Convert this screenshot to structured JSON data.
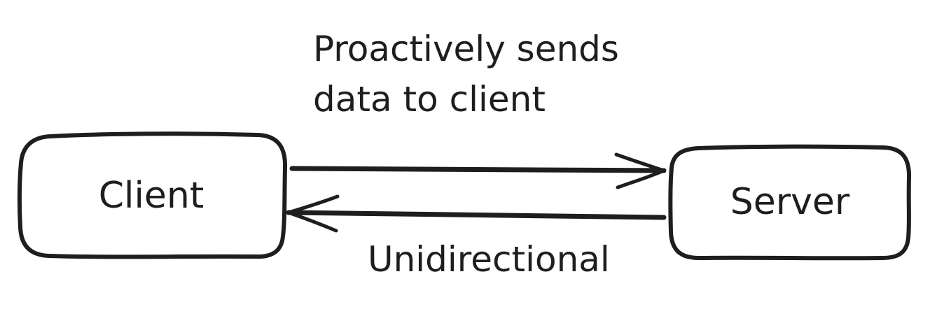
{
  "nodes": {
    "client": {
      "label": "Client"
    },
    "server": {
      "label": "Server"
    }
  },
  "annotations": {
    "top_line_1": "Proactively sends",
    "top_line_2": "data to client",
    "bottom": "Unidirectional"
  },
  "colors": {
    "stroke": "#1e1e1e",
    "background": "#ffffff"
  }
}
